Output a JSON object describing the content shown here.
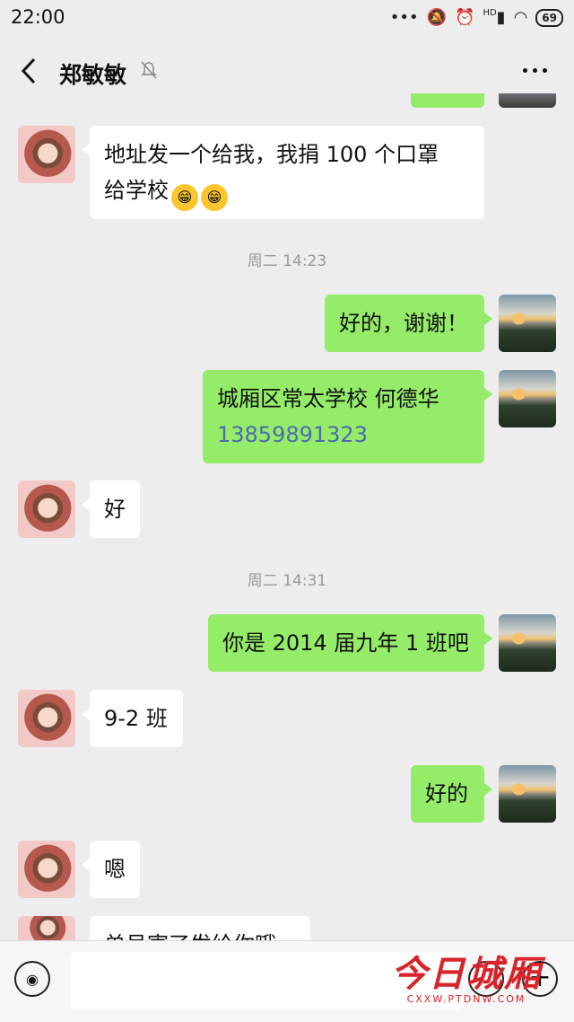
{
  "status": {
    "time": "22:00",
    "signal_label": "HD",
    "battery": "69"
  },
  "header": {
    "title": "郑敏敏",
    "back_icon": "back-arrow-icon",
    "mute_icon": "muted-bell-icon",
    "more_icon": "more-dots-icon"
  },
  "messages": [
    {
      "text_line1": "地址发一个给我，我捐 100 个口罩",
      "text_line2": "给学校",
      "emojis": [
        "😁",
        "😁"
      ]
    },
    {
      "timestamp": "周二 14:23"
    },
    {
      "text": "好的，谢谢！"
    },
    {
      "text": "城厢区常太学校  何德华",
      "phone": "13859891323"
    },
    {
      "text": "好"
    },
    {
      "timestamp": "周二 14:31"
    },
    {
      "text": "你是 2014 届九年 1 班吧"
    },
    {
      "text": "9-2 班"
    },
    {
      "text": "好的"
    },
    {
      "text": "嗯"
    },
    {
      "text": "单号寄了发给你哦"
    }
  ],
  "input": {
    "value": ""
  },
  "watermark": {
    "title": "今日城厢",
    "subtitle": "CXXW.PTDNW.COM"
  },
  "colors": {
    "outgoing_bubble": "#95ec69",
    "incoming_bubble": "#ffffff",
    "background": "#ededed",
    "link": "#4a6db0"
  }
}
